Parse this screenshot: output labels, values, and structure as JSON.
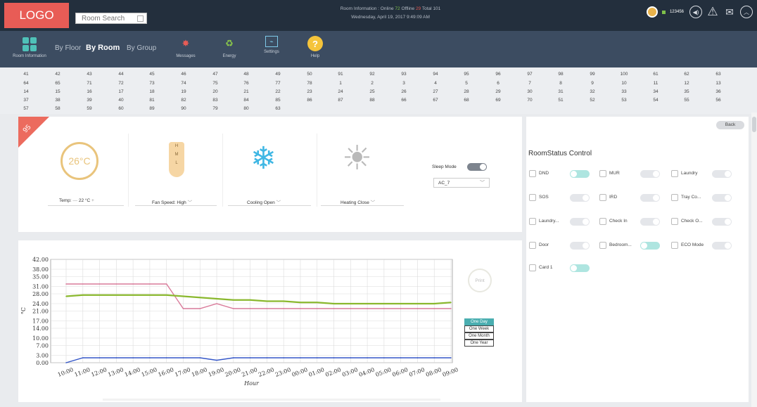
{
  "header": {
    "logo": "LOGO",
    "search_placeholder": "Room Search",
    "room_info_label": "Room Information :",
    "online_label": "Online",
    "online_count": "72",
    "offline_label": "Offline",
    "offline_count": "29",
    "total_label": "Total",
    "total_count": "101",
    "datetime": "Wednesday, April 19, 2017 9:49:09 AM",
    "user_id": "123456"
  },
  "nav": {
    "room_information": "Room Information",
    "by_floor": "By Floor",
    "by_room": "By Room",
    "by_group": "By Group",
    "messages": "Messages",
    "energy": "Energy",
    "settings": "Settings",
    "help": "Help"
  },
  "rooms": [
    [
      "41",
      "42",
      "43",
      "44",
      "45",
      "46",
      "47",
      "48",
      "49",
      "50",
      "91",
      "92",
      "93",
      "94",
      "95",
      "96",
      "97",
      "98",
      "99",
      "100",
      "61",
      "62",
      "63"
    ],
    [
      "64",
      "65",
      "71",
      "72",
      "73",
      "74",
      "75",
      "76",
      "77",
      "78",
      "1",
      "2",
      "3",
      "4",
      "5",
      "6",
      "7",
      "8",
      "9",
      "10",
      "11",
      "12",
      "13"
    ],
    [
      "14",
      "15",
      "16",
      "17",
      "18",
      "19",
      "20",
      "21",
      "22",
      "23",
      "24",
      "25",
      "26",
      "27",
      "28",
      "29",
      "30",
      "31",
      "32",
      "33",
      "34",
      "35",
      "36"
    ],
    [
      "37",
      "38",
      "39",
      "40",
      "81",
      "82",
      "83",
      "84",
      "85",
      "86",
      "87",
      "88",
      "66",
      "67",
      "68",
      "69",
      "70",
      "51",
      "52",
      "53",
      "54",
      "55",
      "56"
    ],
    [
      "57",
      "58",
      "59",
      "60",
      "89",
      "90",
      "79",
      "80",
      "63"
    ]
  ],
  "ac": {
    "room_number": "95",
    "temp_display": "26°C",
    "temp_label": "Temp:",
    "minus": "—",
    "setpoint": "22",
    "unit": "°C",
    "plus": "+",
    "fan_levels": [
      "H",
      "M",
      "L"
    ],
    "fan_speed_label": "Fan Speed:",
    "fan_speed_value": "High",
    "cooling_label": "Cooling",
    "cooling_value": "Open",
    "heating_label": "Heating",
    "heating_value": "Close",
    "sleep_mode_label": "Sleep Mode",
    "sleep_mode_on": false,
    "ac_select": "AC_7"
  },
  "room_status": {
    "back_label": "Back",
    "title": "RoomStatus Control",
    "items": [
      {
        "label": "DND",
        "icon": "dnd-icon",
        "on": true
      },
      {
        "label": "MUR",
        "icon": "mur-icon",
        "on": false
      },
      {
        "label": "Laundry",
        "icon": "laundry-icon",
        "on": false
      },
      {
        "label": "SOS",
        "icon": "sos-icon",
        "on": false
      },
      {
        "label": "IRD",
        "icon": "ird-icon",
        "on": false
      },
      {
        "label": "Tray Co...",
        "icon": "tray-icon",
        "on": false
      },
      {
        "label": "Laundry...",
        "icon": "laundry-icon",
        "on": false
      },
      {
        "label": "Check In",
        "icon": "check-in-icon",
        "on": false
      },
      {
        "label": "Check O...",
        "icon": "check-out-icon",
        "on": false
      },
      {
        "label": "Door",
        "icon": "door-icon",
        "on": false
      },
      {
        "label": "Bedroom...",
        "icon": "bedroom-icon",
        "on": true
      },
      {
        "label": "ECO Mode",
        "icon": "eco-icon",
        "on": false
      },
      {
        "label": "Card 1",
        "icon": "card-icon",
        "on": true
      }
    ]
  },
  "history": {
    "print_label": "Print",
    "periods": [
      "One Day",
      "One Week",
      "One Month",
      "One Year"
    ],
    "selected_period": "One Day"
  },
  "chart_data": {
    "type": "line",
    "xlabel": "Hour",
    "ylabel": "°C",
    "ylim": [
      0,
      42
    ],
    "y_ticks": [
      "0.00",
      "3.00",
      "7.00",
      "10.00",
      "14.00",
      "17.00",
      "21.00",
      "24.00",
      "28.00",
      "31.00",
      "35.00",
      "38.00",
      "42.00"
    ],
    "x": [
      "10:00",
      "11:00",
      "12:00",
      "13:00",
      "14:00",
      "15:00",
      "16:00",
      "17:00",
      "18:00",
      "19:00",
      "20:00",
      "21:00",
      "22:00",
      "23:00",
      "00:00",
      "01:00",
      "02:00",
      "03:00",
      "04:00",
      "05:00",
      "06:00",
      "07:00",
      "08:00",
      "09:00"
    ],
    "grid": true,
    "series": [
      {
        "color": "#d97a9a",
        "values": [
          32,
          32,
          32,
          32,
          32,
          32,
          32,
          22,
          22,
          24,
          22,
          22,
          22,
          22,
          22,
          22,
          22,
          22,
          22,
          22,
          22,
          22,
          22,
          22
        ]
      },
      {
        "color": "#8ab82e",
        "values": [
          27,
          27.5,
          27.5,
          27.5,
          27.5,
          27.5,
          27.5,
          27,
          26.5,
          26,
          25.5,
          25.5,
          25,
          25,
          24.5,
          24.5,
          24,
          24,
          24,
          24,
          24,
          24,
          24,
          24.5
        ]
      },
      {
        "color": "#3557c8",
        "values": [
          0,
          2,
          2,
          2,
          2,
          2,
          2,
          2,
          2,
          1,
          2,
          2,
          2,
          2,
          2,
          2,
          2,
          2,
          2,
          2,
          2,
          2,
          2,
          2
        ]
      }
    ]
  }
}
